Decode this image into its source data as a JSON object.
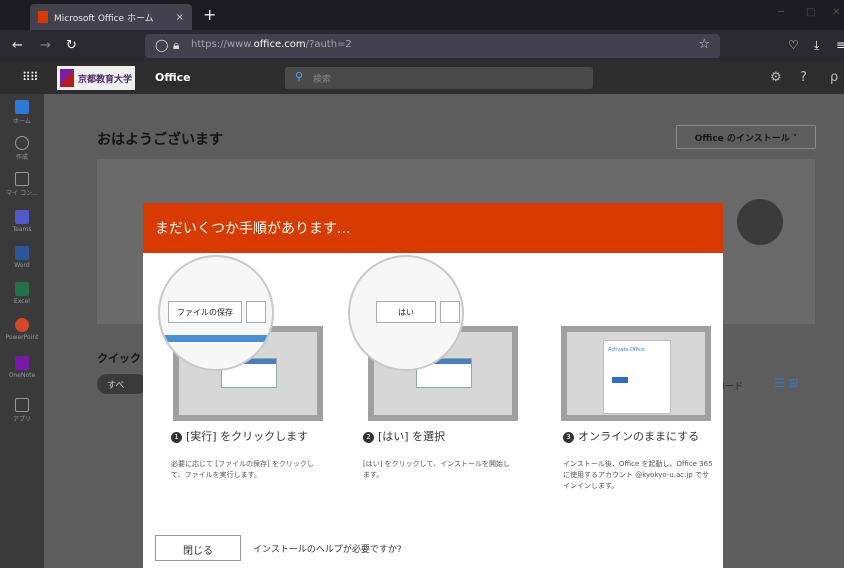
{
  "browser": {
    "tab_title": "Microsoft Office ホーム",
    "tab_close": "×",
    "new_tab": "+",
    "url_prefix": "https://www.",
    "url_domain": "office.com",
    "url_suffix": "/?auth=2"
  },
  "office": {
    "org_name": "京都教育大学",
    "app_name": "Office",
    "search_placeholder": "検索"
  },
  "rail": [
    {
      "label": "ホーム",
      "color": "#2f7ad6"
    },
    {
      "label": "作成",
      "color": "#777777"
    },
    {
      "label": "マイ コン...",
      "color": "#777777"
    },
    {
      "label": "Teams",
      "color": "#5059c9"
    },
    {
      "label": "Word",
      "color": "#2b579a"
    },
    {
      "label": "Excel",
      "color": "#217346"
    },
    {
      "label": "PowerPoint",
      "color": "#d24726"
    },
    {
      "label": "OneNote",
      "color": "#7719aa"
    },
    {
      "label": "アプリ",
      "color": "#777777"
    }
  ],
  "page": {
    "greeting": "おはようございます",
    "install_button": "Office のインストール ˅",
    "quick_access": "クイック",
    "all_pill": "すべ",
    "download_text": "ロード"
  },
  "modal": {
    "title": "まだいくつか手順があります...",
    "steps": [
      {
        "number": "1",
        "zoom_label": "ファイルの保存",
        "heading": "[実行] をクリックします",
        "description": "必要に応じて [ファイルの保存] をクリックして、ファイルを実行します。"
      },
      {
        "number": "2",
        "zoom_label": "はい",
        "heading": "[はい] を選択",
        "description": "[はい] をクリックして、インストールを開始します。"
      },
      {
        "number": "3",
        "zoom_label": "Activate Office",
        "heading": "オンラインのままにする",
        "description": "インストール後、Office を起動し、Office 365 に使用するアカウント @kyokyo-u.ac.jp でサインインします。"
      }
    ],
    "close_button": "閉じる",
    "help_text": "インストールのヘルプが必要ですか?"
  },
  "colors": {
    "accent": "#d83b01",
    "link_blue": "#2a6ebd"
  }
}
